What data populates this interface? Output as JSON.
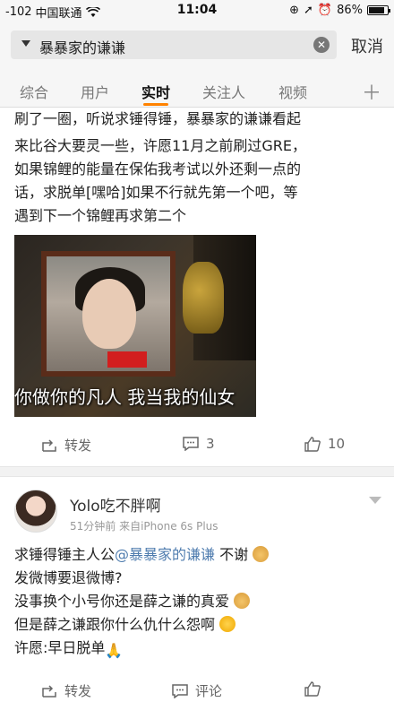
{
  "status_bar": {
    "signal": "-102",
    "carrier": "中国联通",
    "time": "11:04",
    "battery": "86%",
    "battery_level": 0.86
  },
  "search": {
    "query": "暴暴家的谦谦",
    "cancel_label": "取消"
  },
  "tabs": [
    {
      "label": "综合"
    },
    {
      "label": "用户"
    },
    {
      "label": "实时",
      "active": true
    },
    {
      "label": "关注人"
    },
    {
      "label": "视频"
    }
  ],
  "post1": {
    "lines": [
      "刷了一圈，听说求锤得锤，暴暴家的谦谦看起",
      "来比谷大要灵一些，许愿11月之前刷过GRE，",
      "如果锦鲤的能量在保佑我考试以外还剩一点的",
      "话，求脱单[嘿哈]如果不行就先第一个吧，等",
      "遇到下一个锦鲤再求第二个"
    ],
    "image_caption": "你做你的凡人 我当我的仙女",
    "repost_label": "转发",
    "comment_count": "3",
    "like_count": "10"
  },
  "post2": {
    "username": "Yolo吃不胖啊",
    "meta": "51分钟前  来自iPhone 6s Plus",
    "line1_prefix": "求锤得锤主人公",
    "line1_mention": "@暴暴家的谦谦",
    "line1_suffix": " 不谢",
    "line2": "发微博要退微博?",
    "line3": "没事换个小号你还是薛之谦的真爱",
    "line4": "但是薛之谦跟你什么仇什么怨啊",
    "line5": "许愿:早日脱单",
    "repost_label": "转发",
    "comment_label": "评论"
  }
}
